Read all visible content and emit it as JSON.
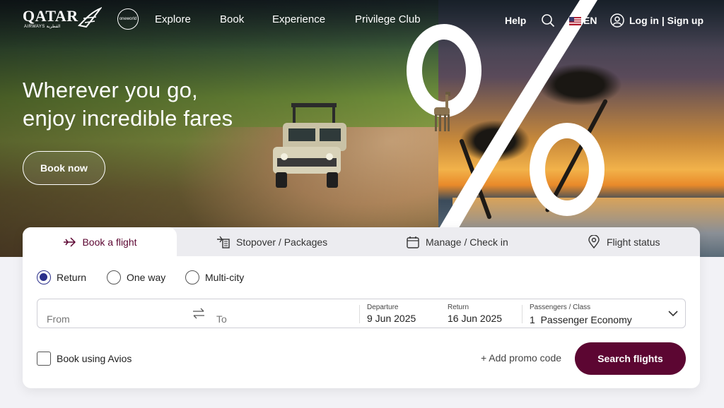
{
  "brand": {
    "name": "QATAR",
    "sub": "AIRWAYS القطرية",
    "alliance": "oneworld"
  },
  "nav": {
    "links": [
      "Explore",
      "Book",
      "Experience",
      "Privilege Club"
    ],
    "help": "Help",
    "language": "EN",
    "login": "Log in | Sign up"
  },
  "hero": {
    "headline_line1": "Wherever you go,",
    "headline_line2": "enjoy incredible fares",
    "cta": "Book now"
  },
  "tabs": [
    {
      "label": "Book a flight",
      "icon": "plane-icon",
      "active": true
    },
    {
      "label": "Stopover / Packages",
      "icon": "hotel-plane-icon"
    },
    {
      "label": "Manage / Check in",
      "icon": "calendar-icon"
    },
    {
      "label": "Flight status",
      "icon": "location-pin-icon"
    }
  ],
  "trip_type": {
    "options": [
      "Return",
      "One way",
      "Multi-city"
    ],
    "selected": "Return"
  },
  "search": {
    "from_placeholder": "From",
    "to_placeholder": "To",
    "departure_label": "Departure",
    "departure_value": "9 Jun 2025",
    "return_label": "Return",
    "return_value": "16 Jun 2025",
    "passengers_label": "Passengers / Class",
    "passengers_value": "1  Passenger Economy"
  },
  "options": {
    "avios_label": "Book using Avios",
    "promo": "+ Add promo code",
    "submit": "Search flights"
  },
  "colors": {
    "brand": "#5c0632",
    "radio": "#2a2f8a"
  }
}
